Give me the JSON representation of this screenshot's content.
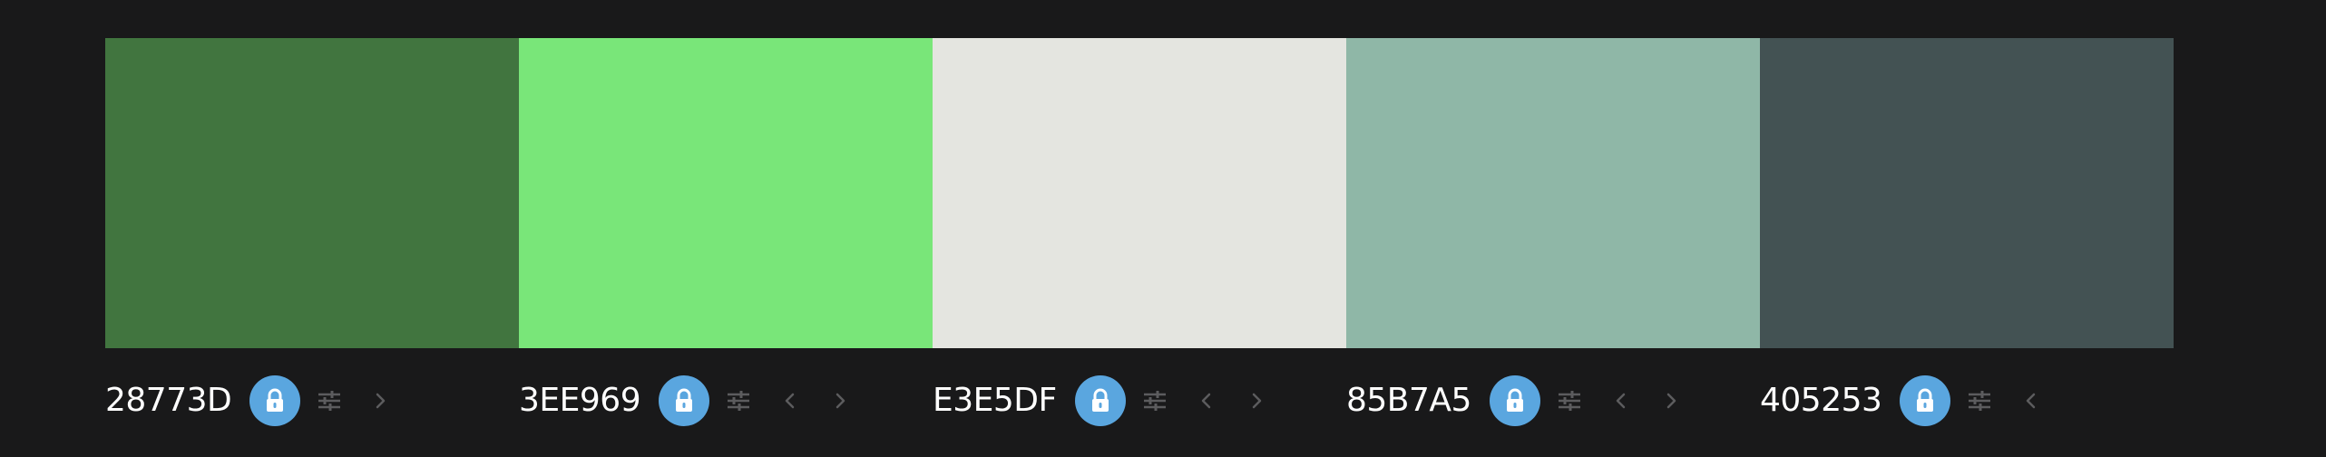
{
  "colors": [
    {
      "hex": "28773D",
      "swatch": "#41753f",
      "arrows": [
        "right"
      ]
    },
    {
      "hex": "3EE969",
      "swatch": "#79e679",
      "arrows": [
        "left",
        "right"
      ]
    },
    {
      "hex": "E3E5DF",
      "swatch": "#e4e5e0",
      "arrows": [
        "left",
        "right"
      ]
    },
    {
      "hex": "85B7A5",
      "swatch": "#8fb7a7",
      "arrows": [
        "left",
        "right"
      ]
    },
    {
      "hex": "405253",
      "swatch": "#435253",
      "arrows": [
        "left"
      ]
    }
  ],
  "ui_colors": {
    "background": "#19191a",
    "lock_button": "#5aa6df",
    "icon_muted": "#5c5c5e",
    "text": "#ffffff"
  },
  "icons": {
    "lock": "lock-icon",
    "adjust": "sliders-icon",
    "left": "chevron-left-icon",
    "right": "chevron-right-icon"
  }
}
